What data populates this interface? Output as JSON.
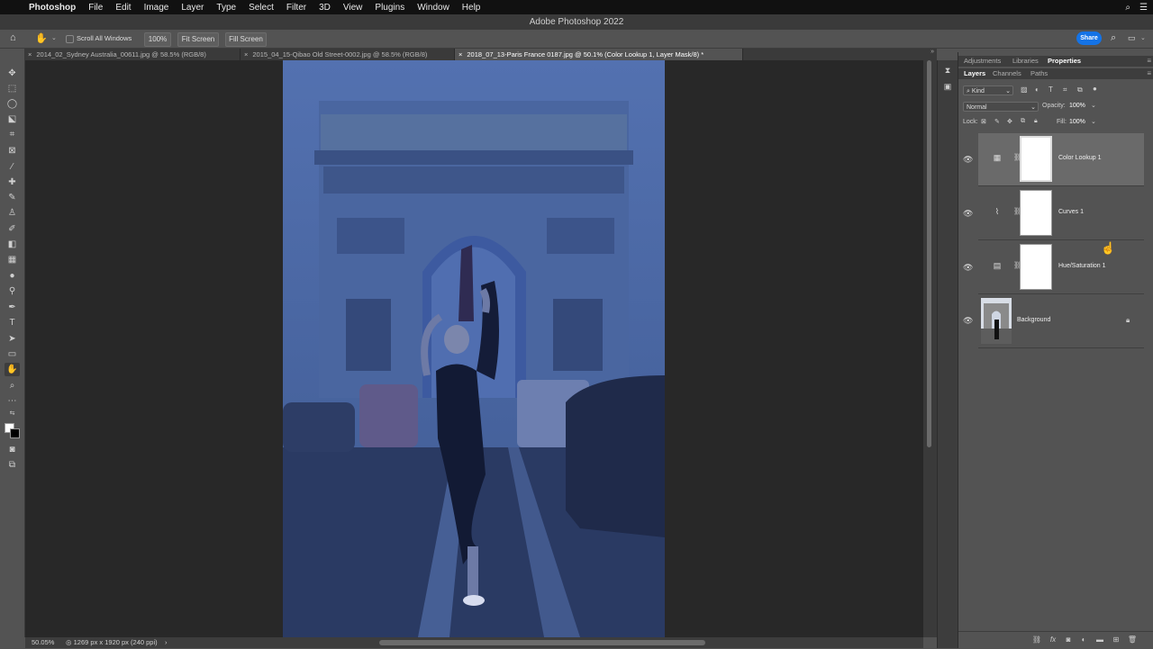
{
  "menubar": {
    "app": "Photoshop",
    "items": [
      "File",
      "Edit",
      "Image",
      "Layer",
      "Type",
      "Select",
      "Filter",
      "3D",
      "View",
      "Plugins",
      "Window",
      "Help"
    ]
  },
  "window_title": "Adobe Photoshop 2022",
  "options": {
    "scroll_all_windows": "Scroll All Windows",
    "zoom": "100%",
    "fit_screen": "Fit Screen",
    "fill_screen": "Fill Screen",
    "share": "Share"
  },
  "tabs": [
    {
      "label": "2014_02_Sydney Australia_00611.jpg @ 58.5% (RGB/8)"
    },
    {
      "label": "2015_04_15-Qibao Old Street-0002.jpg @ 58.5% (RGB/8)"
    },
    {
      "label": "2018_07_13-Paris France 0187.jpg @ 50.1% (Color Lookup 1, Layer Mask/8) *"
    }
  ],
  "status": {
    "zoom": "50.05%",
    "info": "1269 px x 1920 px (240 ppi)"
  },
  "panels": {
    "top_tabs": [
      "Adjustments",
      "Libraries",
      "Properties"
    ],
    "layer_tabs": [
      "Layers",
      "Channels",
      "Paths"
    ],
    "filter_kind": "Kind",
    "blend_mode": "Normal",
    "opacity_label": "Opacity:",
    "opacity": "100%",
    "lock_label": "Lock:",
    "fill_label": "Fill:",
    "fill": "100%"
  },
  "layers": [
    {
      "name": "Color Lookup 1"
    },
    {
      "name": "Curves 1"
    },
    {
      "name": "Hue/Saturation 1"
    },
    {
      "name": "Background"
    }
  ]
}
